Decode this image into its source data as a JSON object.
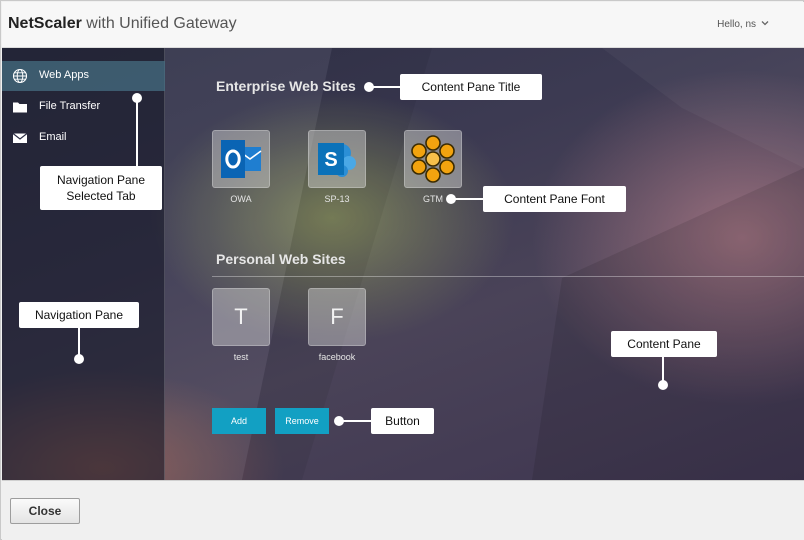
{
  "header": {
    "brand_bold": "NetScaler",
    "brand_rest": " with Unified Gateway",
    "user_greeting": "Hello, ns"
  },
  "nav": {
    "items": [
      {
        "label": "Web Apps",
        "icon": "globe-icon",
        "selected": true
      },
      {
        "label": "File Transfer",
        "icon": "folder-icon",
        "selected": false
      },
      {
        "label": "Email",
        "icon": "envelope-icon",
        "selected": false
      }
    ]
  },
  "content": {
    "enterprise_title": "Enterprise Web Sites",
    "enterprise_apps": [
      {
        "label": "OWA",
        "icon": "outlook-icon"
      },
      {
        "label": "SP-13",
        "icon": "sharepoint-icon"
      },
      {
        "label": "GTM",
        "icon": "gotomeeting-icon"
      }
    ],
    "personal_title": "Personal Web Sites",
    "personal_sites": [
      {
        "letter": "T",
        "label": "test"
      },
      {
        "letter": "F",
        "label": "facebook"
      }
    ],
    "add_label": "Add",
    "remove_label": "Remove"
  },
  "callouts": {
    "content_pane_title": "Content Pane Title",
    "nav_selected_tab": "Navigation Pane Selected Tab",
    "content_pane_font": "Content Pane Font",
    "navigation_pane": "Navigation Pane",
    "content_pane": "Content Pane",
    "button": "Button"
  },
  "footer": {
    "close_label": "Close"
  },
  "colors": {
    "accent_button": "#12a0c3",
    "selected_tab": "#466e82",
    "outlook_blue": "#0a64b4",
    "sharepoint_blue": "#0b72b9",
    "gtm_orange": "#f2a30f"
  }
}
